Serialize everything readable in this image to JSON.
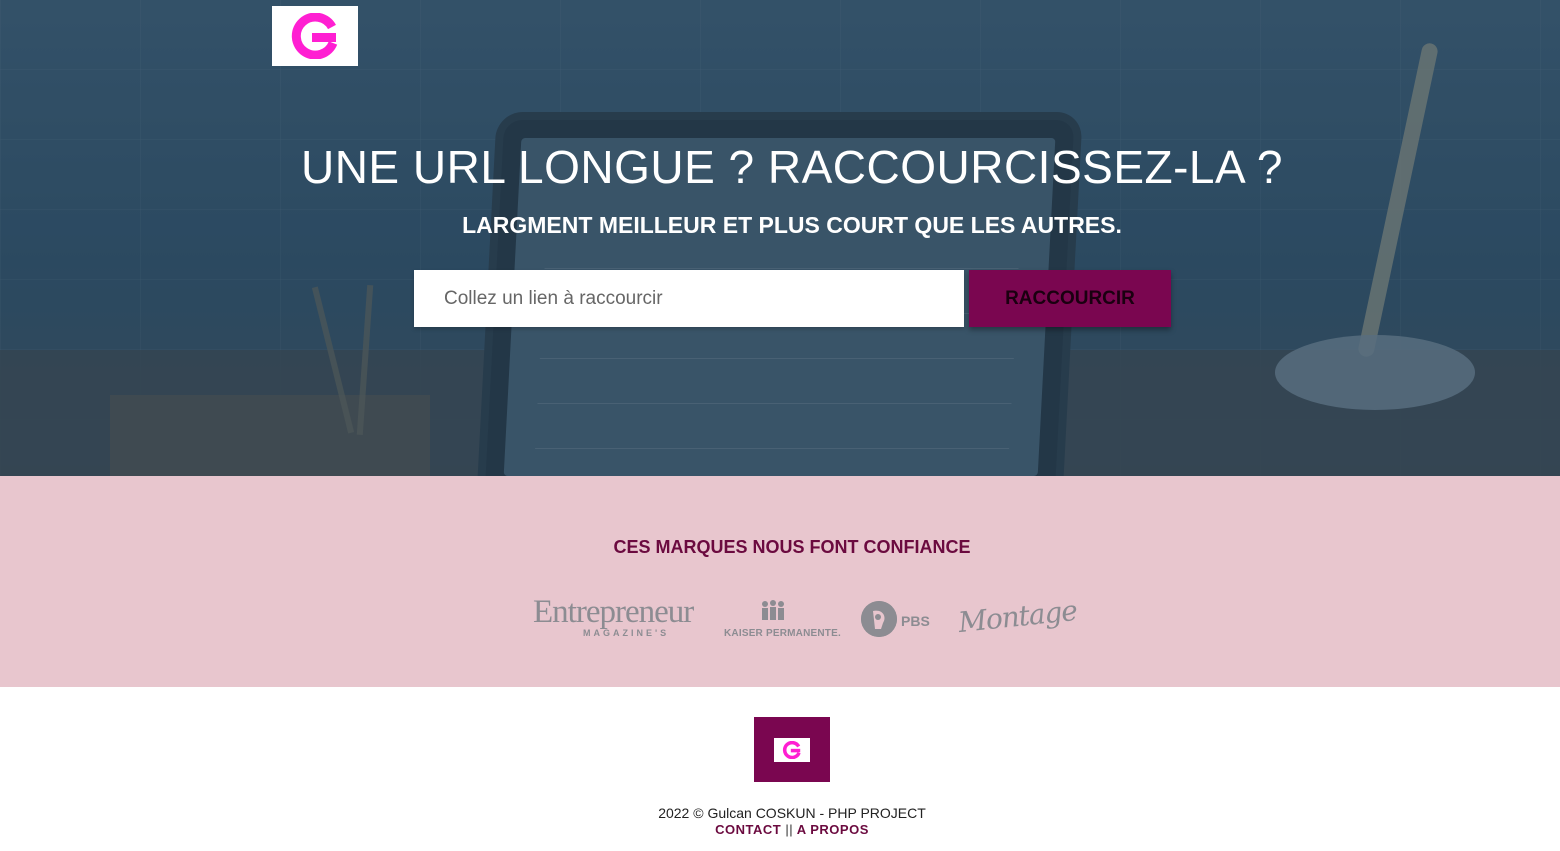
{
  "hero": {
    "title": "UNE URL LONGUE ? RACCOURCISSEZ-LA ?",
    "subtitle": "LARGMENT MEILLEUR ET PLUS COURT QUE LES AUTRES.",
    "input_placeholder": "Collez un lien à raccourcir",
    "button_label": "RACCOURCIR"
  },
  "brands": {
    "heading": "CES MARQUES NOUS FONT CONFIANCE",
    "logos": [
      {
        "name": "Entrepreneur",
        "subtext": "MAGAZINE'S"
      },
      {
        "name": "KAISER PERMANENTE."
      },
      {
        "name": "PBS"
      },
      {
        "name": "Montage"
      }
    ]
  },
  "footer": {
    "copyright": "2022 © Gulcan COSKUN - PHP PROJECT",
    "contact_label": "CONTACT",
    "separator": "||",
    "about_label": "A PROPOS"
  },
  "colors": {
    "brand_magenta": "#ff1fd2",
    "brand_purple": "#7a0650",
    "brands_bg": "#e8c6ce",
    "heading_color": "#6b0a3f"
  }
}
